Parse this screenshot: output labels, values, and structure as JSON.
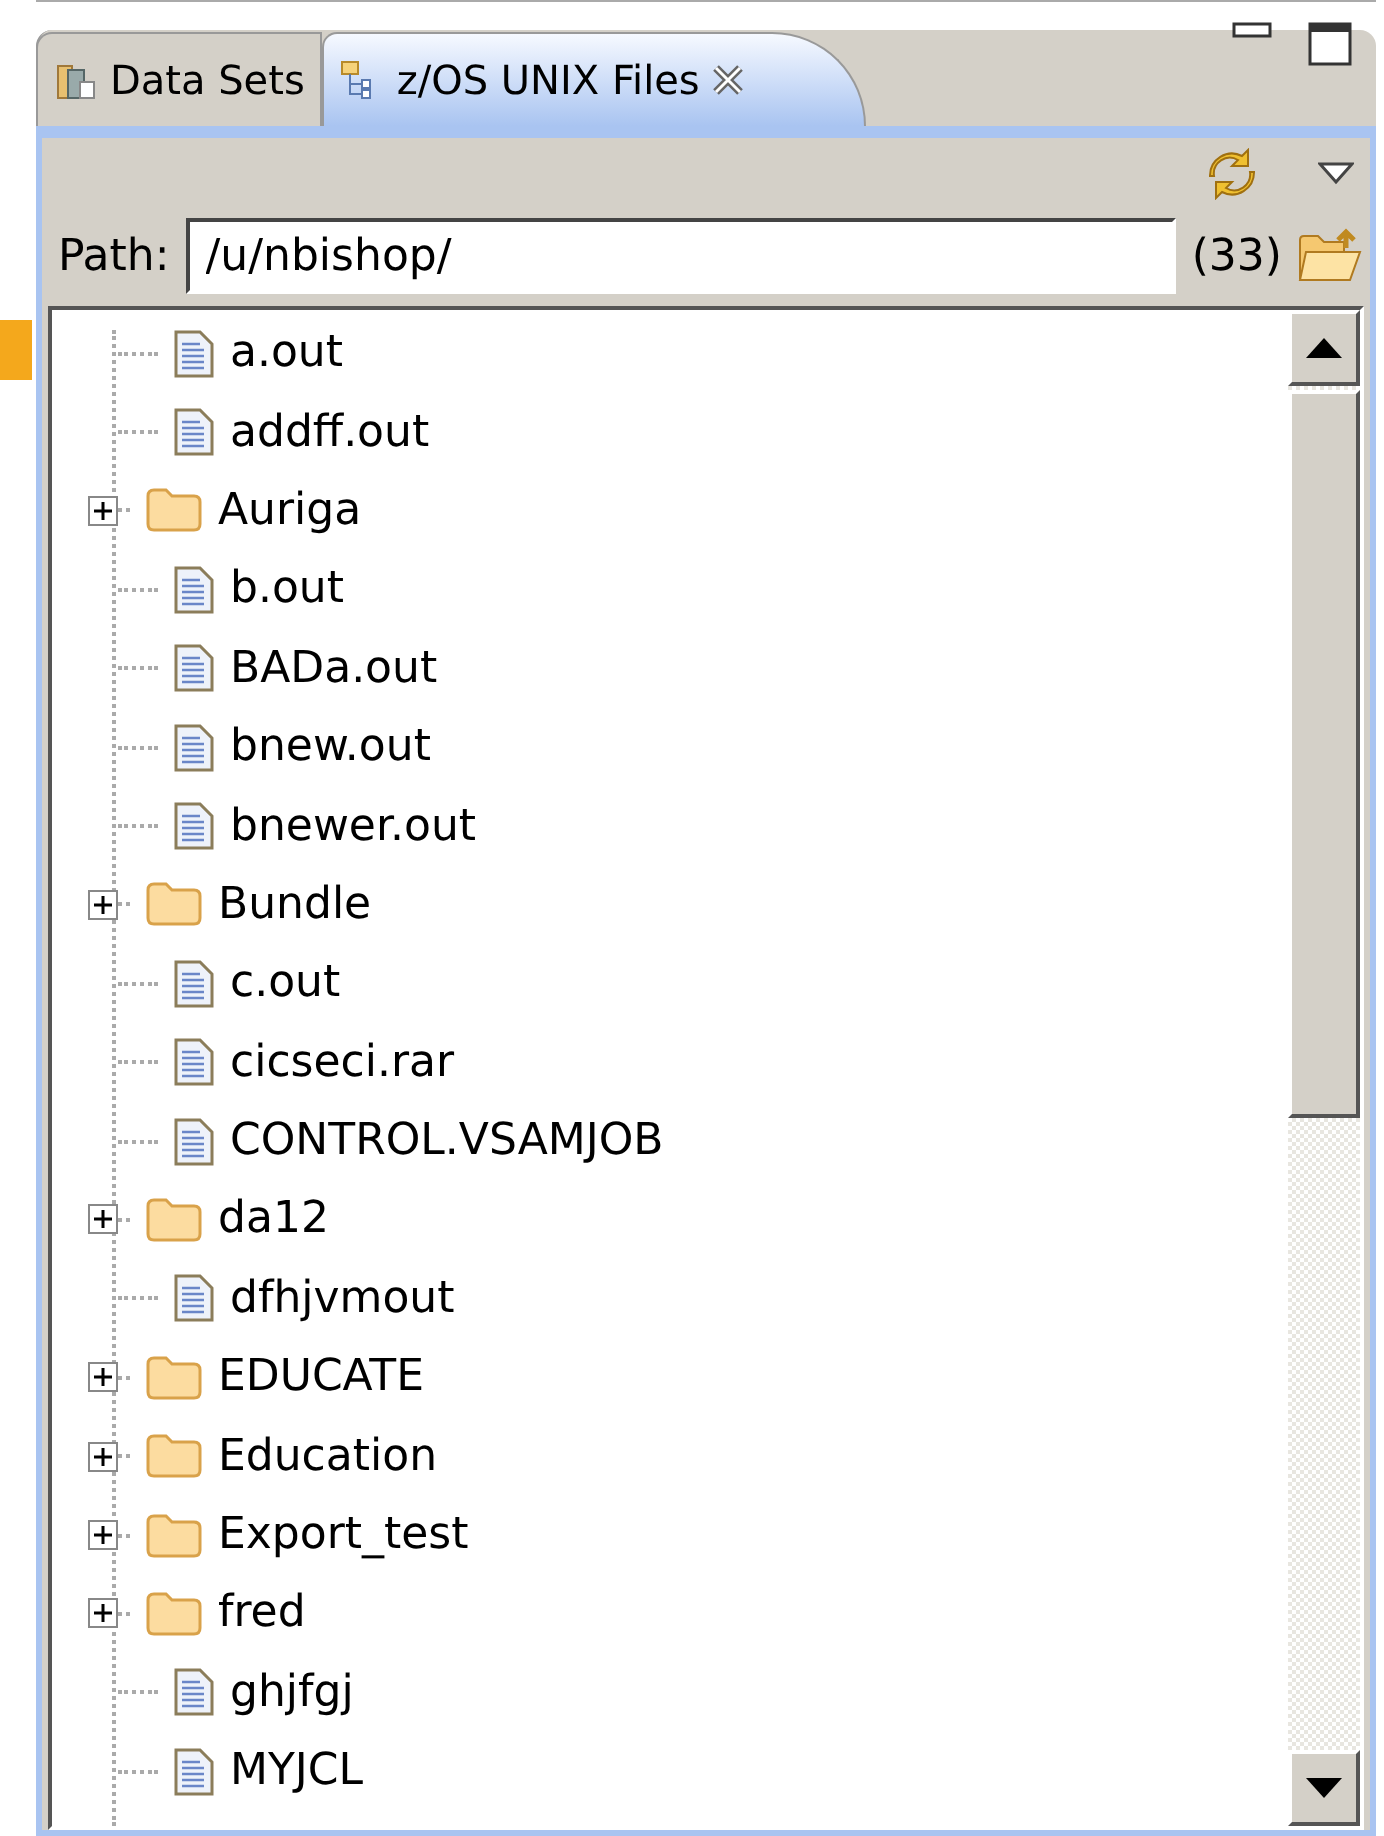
{
  "tabs": [
    {
      "label": "Data Sets",
      "selected": false,
      "closable": false
    },
    {
      "label": "z/OS UNIX Files",
      "selected": true,
      "closable": true
    }
  ],
  "path": {
    "label": "Path:",
    "value": "/u/nbishop/",
    "count": "(33)"
  },
  "tree": [
    {
      "kind": "file",
      "name": "a.out"
    },
    {
      "kind": "file",
      "name": "addff.out"
    },
    {
      "kind": "folder",
      "name": "Auriga",
      "expanded": false
    },
    {
      "kind": "file",
      "name": "b.out"
    },
    {
      "kind": "file",
      "name": "BADa.out"
    },
    {
      "kind": "file",
      "name": "bnew.out"
    },
    {
      "kind": "file",
      "name": "bnewer.out"
    },
    {
      "kind": "folder",
      "name": "Bundle",
      "expanded": false
    },
    {
      "kind": "file",
      "name": "c.out"
    },
    {
      "kind": "file",
      "name": "cicseci.rar"
    },
    {
      "kind": "file",
      "name": "CONTROL.VSAMJOB"
    },
    {
      "kind": "folder",
      "name": "da12",
      "expanded": false
    },
    {
      "kind": "file",
      "name": "dfhjvmout"
    },
    {
      "kind": "folder",
      "name": "EDUCATE",
      "expanded": false
    },
    {
      "kind": "folder",
      "name": "Education",
      "expanded": false
    },
    {
      "kind": "folder",
      "name": "Export_test",
      "expanded": false
    },
    {
      "kind": "folder",
      "name": "fred",
      "expanded": false
    },
    {
      "kind": "file",
      "name": "ghjfgj"
    },
    {
      "kind": "file",
      "name": "MYJCL"
    }
  ]
}
